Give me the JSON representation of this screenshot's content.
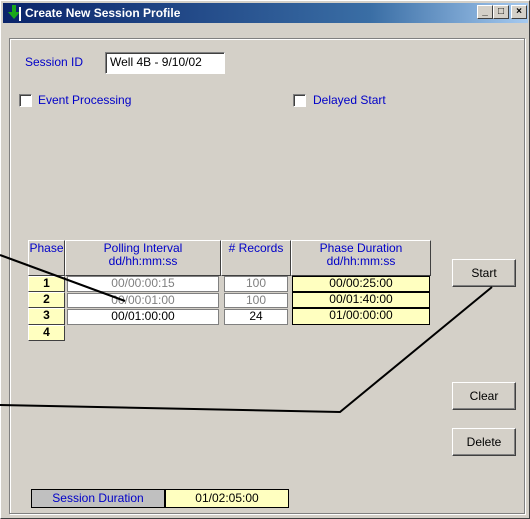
{
  "window": {
    "title": "Create New Session Profile",
    "controls": {
      "minimize": "_",
      "maximize": "□",
      "close": "×"
    }
  },
  "session": {
    "id_label": "Session ID",
    "id_value": "Well 4B - 9/10/02"
  },
  "options": {
    "event_processing": {
      "label": "Event Processing",
      "checked": false
    },
    "delayed_start": {
      "label": "Delayed Start",
      "checked": false
    }
  },
  "table": {
    "headers": {
      "phase": "Phase",
      "polling_line1": "Polling Interval",
      "polling_line2": "dd/hh:mm:ss",
      "records": "# Records",
      "duration_line1": "Phase Duration",
      "duration_line2": "dd/hh:mm:ss"
    },
    "rows": [
      {
        "phase": "1",
        "polling": "00/00:00:15",
        "records": "100",
        "duration": "00/00:25:00"
      },
      {
        "phase": "2",
        "polling": "00/00:01:00",
        "records": "100",
        "duration": "00/01:40:00"
      },
      {
        "phase": "3",
        "polling": "00/01:00:00",
        "records": "24",
        "duration": "01/00:00:00"
      },
      {
        "phase": "4"
      }
    ]
  },
  "buttons": {
    "start": "Start",
    "clear": "Clear",
    "delete": "Delete"
  },
  "summary": {
    "label": "Session Duration",
    "value": "01/02:05:00"
  },
  "colors": {
    "label_blue": "#0000c8",
    "cell_yellow": "#ffffc0",
    "face": "#d4d0c8",
    "title_blue": "#0a246a"
  },
  "icons": {
    "title": "green-down-arrow-icon"
  }
}
